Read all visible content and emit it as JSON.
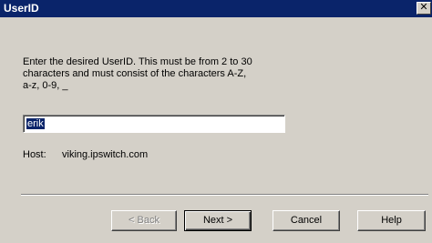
{
  "window": {
    "title": "UserID",
    "close_glyph": "✕"
  },
  "instructions": {
    "line1": "Enter the desired UserID.  This must be from 2 to 30",
    "line2": "characters and must consist of the characters A-Z,",
    "line3": "a-z, 0-9, _"
  },
  "userid_field": {
    "value": "erik"
  },
  "host": {
    "label": "Host:",
    "value": "viking.ipswitch.com"
  },
  "buttons": {
    "back": "< Back",
    "next": "Next >",
    "cancel": "Cancel",
    "help": "Help"
  },
  "colors": {
    "titlebar": "#0a246a",
    "dialog_bg": "#d4d0c8",
    "selection": "#0a246a"
  }
}
